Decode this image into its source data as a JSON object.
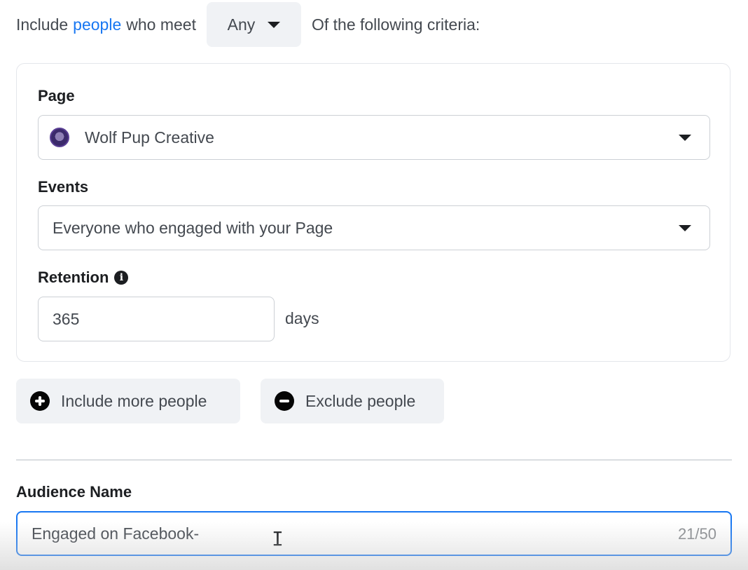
{
  "include_row": {
    "prefix": "Include",
    "link": "people",
    "middle": "who meet",
    "match_value": "Any",
    "suffix": "Of the following criteria:"
  },
  "criteria_card": {
    "page_label": "Page",
    "page_value": "Wolf Pup Creative",
    "events_label": "Events",
    "events_value": "Everyone who engaged with your Page",
    "retention_label": "Retention",
    "retention_value": "365",
    "retention_unit": "days"
  },
  "actions": {
    "include_more": "Include more people",
    "exclude": "Exclude people"
  },
  "audience": {
    "label": "Audience Name",
    "value": "Engaged on Facebook-",
    "counter": "21/50"
  },
  "icons": {
    "caret": "caret-down-icon",
    "info": "info-icon",
    "plus": "plus-circle-icon",
    "minus": "minus-circle-icon",
    "avatar": "page-avatar",
    "cursor": "text-cursor-icon"
  },
  "colors": {
    "link": "#1877f2",
    "focus_border": "#1877f2",
    "pill_bg": "#f0f2f5"
  }
}
